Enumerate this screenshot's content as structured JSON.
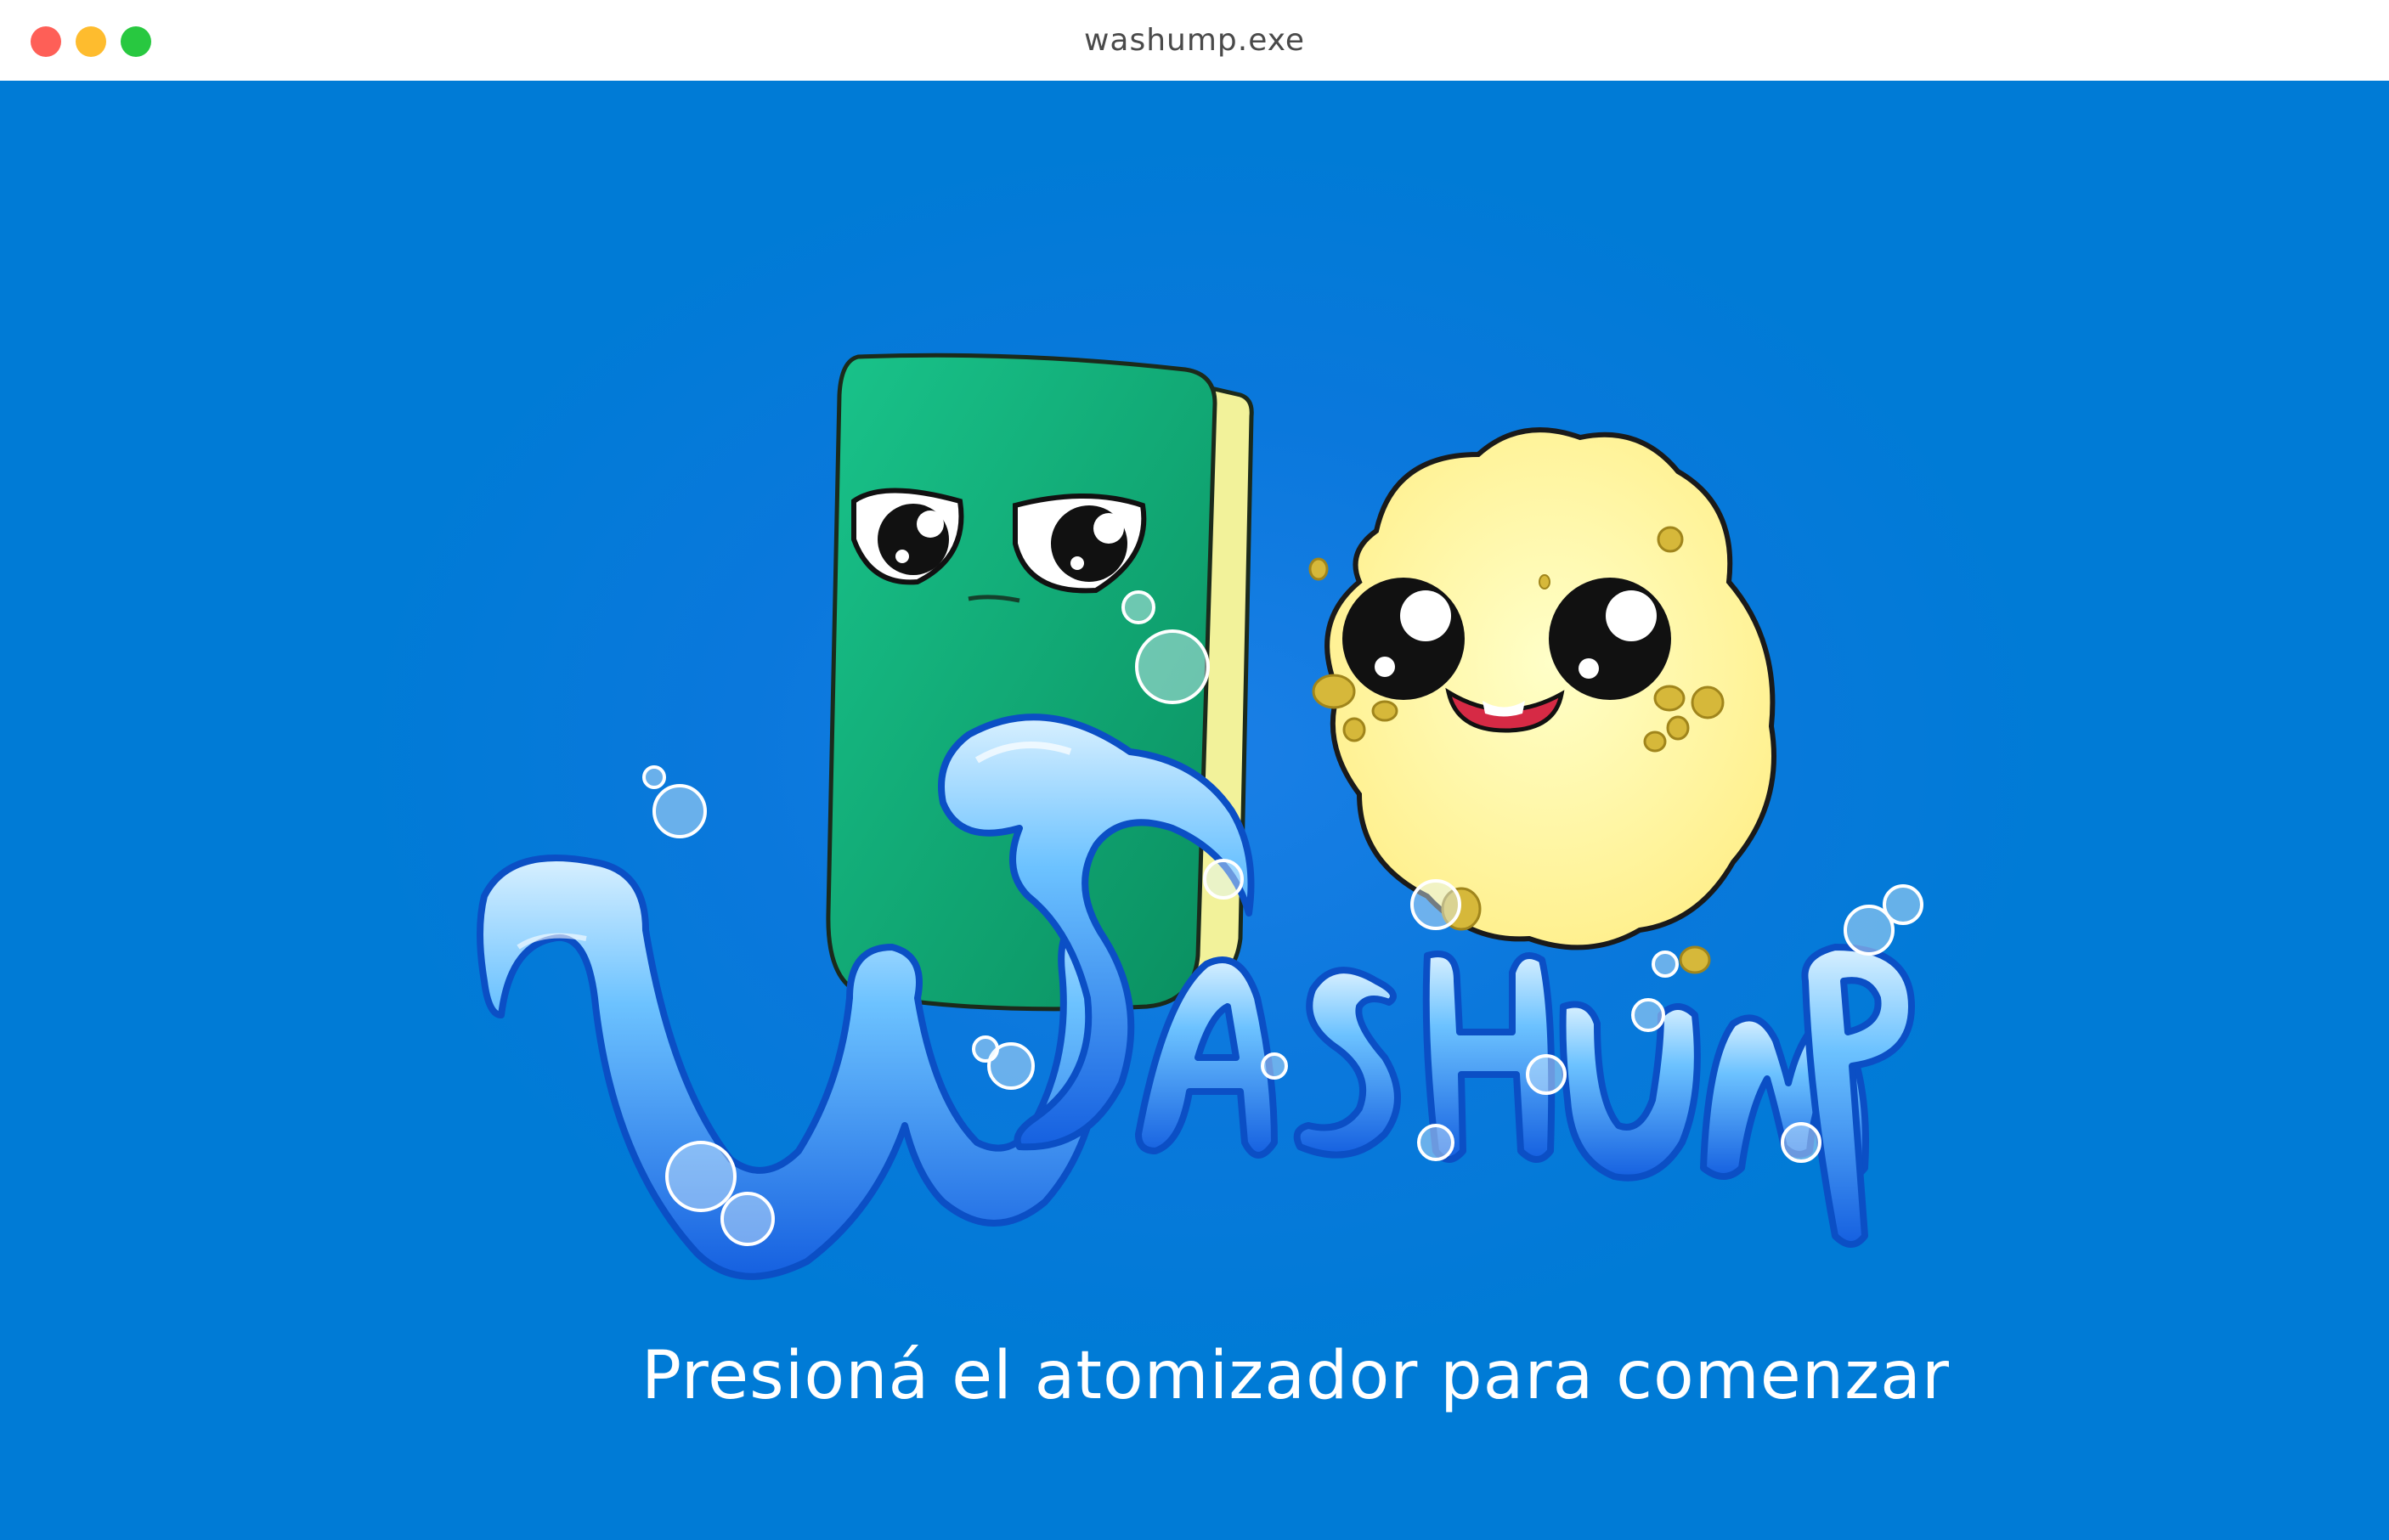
{
  "window": {
    "title": "washump.exe",
    "controls": {
      "close_color": "#fe5f57",
      "minimize_color": "#febc2e",
      "maximize_color": "#28c840"
    }
  },
  "game": {
    "background_color": "#007bd6",
    "logo": {
      "wordmark": "WASHUMP",
      "characters": [
        "green-sponge-character",
        "yellow-sponge-character"
      ]
    },
    "prompt": "Presioná el atomizador para comenzar"
  }
}
